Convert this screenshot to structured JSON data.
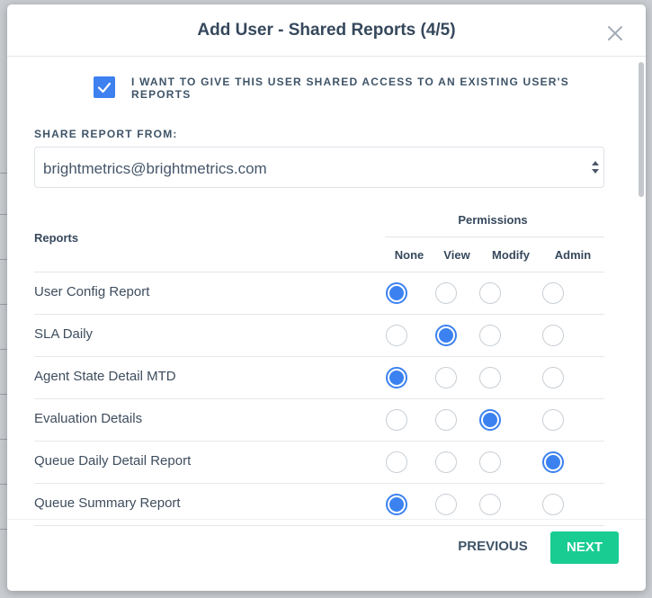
{
  "dialog": {
    "title": "Add User - Shared Reports (4/5)",
    "close_icon": "close-icon"
  },
  "share_access": {
    "checked": true,
    "label": "I WANT TO GIVE THIS USER SHARED ACCESS TO AN EXISTING USER'S REPORTS"
  },
  "share_from": {
    "label": "SHARE REPORT FROM:",
    "selected_value": "brightmetrics@brightmetrics.com"
  },
  "table": {
    "reports_header": "Reports",
    "permissions_header": "Permissions",
    "columns": [
      "None",
      "View",
      "Modify",
      "Admin"
    ],
    "rows": [
      {
        "label": "User Config Report",
        "selected": "None"
      },
      {
        "label": "SLA Daily",
        "selected": "View"
      },
      {
        "label": "Agent State Detail MTD",
        "selected": "None"
      },
      {
        "label": "Evaluation Details",
        "selected": "Modify"
      },
      {
        "label": "Queue Daily Detail Report",
        "selected": "Admin"
      },
      {
        "label": "Queue Summary Report",
        "selected": "None"
      }
    ]
  },
  "footer": {
    "previous_label": "PREVIOUS",
    "next_label": "NEXT"
  },
  "colors": {
    "accent_blue": "#3b82f0",
    "next_green": "#19cc92",
    "title_text": "#36485c"
  }
}
